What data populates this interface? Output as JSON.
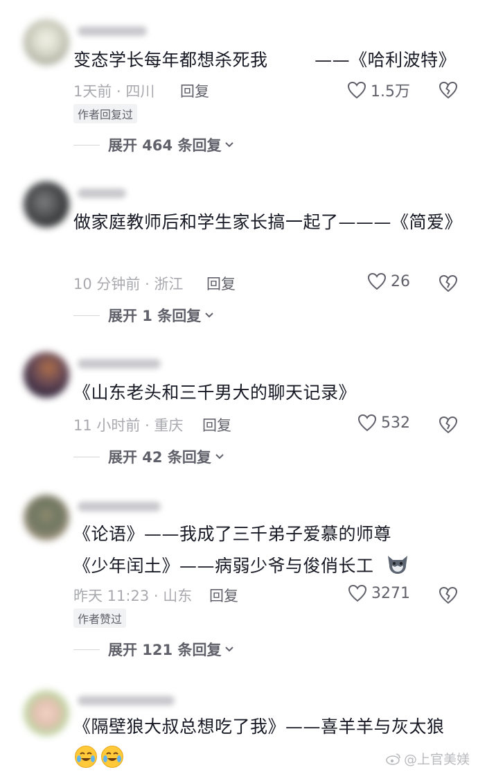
{
  "comments": [
    {
      "text": "变态学长每年都想杀死我        ——《哈利波特》",
      "time": "1天前 · 四川",
      "reply": "回复",
      "likes": "1.5万",
      "badge": "作者回复过",
      "expand": "展开 464 条回复"
    },
    {
      "text": "做家庭教师后和学生家长搞一起了———《简爱》",
      "time": "10 分钟前 · 浙江",
      "reply": "回复",
      "likes": "26",
      "expand": "展开 1 条回复"
    },
    {
      "text": "《山东老头和三千男大的聊天记录》",
      "time": "11 小时前 · 重庆",
      "reply": "回复",
      "likes": "532",
      "expand": "展开 42 条回复"
    },
    {
      "text": "《论语》——我成了三千弟子爱慕的师尊\n《少年闰土》——病弱少爷与俊俏长工",
      "time": "昨天 11:23 · 山东",
      "reply": "回复",
      "likes": "3271",
      "badge": "作者赞过",
      "expand": "展开 121 条回复"
    },
    {
      "text": "《隔壁狼大叔总想吃了我》——喜羊羊与灰太狼"
    }
  ],
  "watermark": "@上官美媄",
  "icons": {
    "like": "heart-outline-icon",
    "dislike": "broken-heart-icon",
    "expand": "chevron-down-icon"
  }
}
